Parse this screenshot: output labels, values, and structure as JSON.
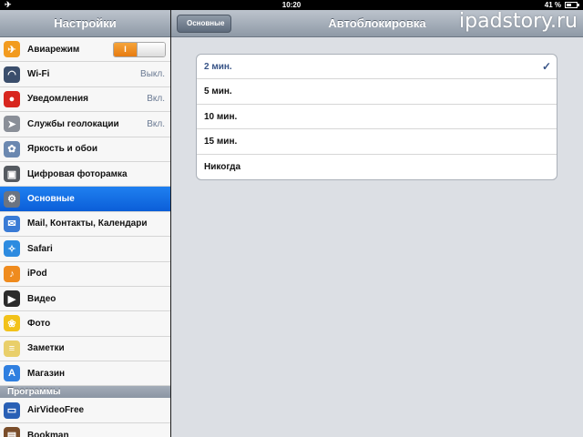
{
  "status": {
    "time": "10:20",
    "battery": "41 %",
    "airplane_icon": "airplane-icon"
  },
  "left": {
    "title": "Настройки",
    "items": [
      {
        "label": "Авиарежим",
        "icon": "airplane-icon",
        "color": "#f29b1f",
        "glyph": "✈",
        "toggle": "I"
      },
      {
        "label": "Wi-Fi",
        "icon": "wifi-icon",
        "color": "#3b4e6c",
        "glyph": "◠",
        "value": "Выкл."
      },
      {
        "label": "Уведомления",
        "icon": "notifications-icon",
        "color": "#d8261e",
        "glyph": "●",
        "value": "Вкл."
      },
      {
        "label": "Службы геолокации",
        "icon": "location-icon",
        "color": "#8a8f98",
        "glyph": "➤",
        "value": "Вкл."
      },
      {
        "label": "Яркость и обои",
        "icon": "brightness-icon",
        "color": "#6b88b0",
        "glyph": "✿"
      },
      {
        "label": "Цифровая фоторамка",
        "icon": "photo-frame-icon",
        "color": "#555a60",
        "glyph": "▣"
      },
      {
        "label": "Основные",
        "icon": "gear-icon",
        "color": "#6b7482",
        "glyph": "⚙",
        "selected": true
      },
      {
        "label": "Mail, Контакты, Календари",
        "icon": "mail-icon",
        "color": "#3a7bd5",
        "glyph": "✉"
      },
      {
        "label": "Safari",
        "icon": "safari-icon",
        "color": "#2d8be0",
        "glyph": "✧"
      },
      {
        "label": "iPod",
        "icon": "ipod-icon",
        "color": "#ef8b1e",
        "glyph": "♪"
      },
      {
        "label": "Видео",
        "icon": "video-icon",
        "color": "#2b2b2b",
        "glyph": "▶"
      },
      {
        "label": "Фото",
        "icon": "photos-icon",
        "color": "#f2c21a",
        "glyph": "❀"
      },
      {
        "label": "Заметки",
        "icon": "notes-icon",
        "color": "#e9cf6a",
        "glyph": "≡"
      },
      {
        "label": "Магазин",
        "icon": "store-icon",
        "color": "#2f7fe0",
        "glyph": "A"
      }
    ],
    "section_programs": "Программы",
    "apps": [
      {
        "label": "AirVideoFree",
        "icon": "airvideo-icon",
        "color": "#2960b5",
        "glyph": "▭"
      },
      {
        "label": "Bookman",
        "icon": "bookman-icon",
        "color": "#7a4d2a",
        "glyph": "▤"
      }
    ]
  },
  "right": {
    "back_label": "Основные",
    "title": "Автоблокировка",
    "watermark": "ipadstory.ru",
    "options": [
      {
        "label": "2 мин.",
        "checked": true
      },
      {
        "label": "5 мин."
      },
      {
        "label": "10 мин."
      },
      {
        "label": "15 мин."
      },
      {
        "label": "Никогда"
      }
    ],
    "check_glyph": "✓"
  }
}
